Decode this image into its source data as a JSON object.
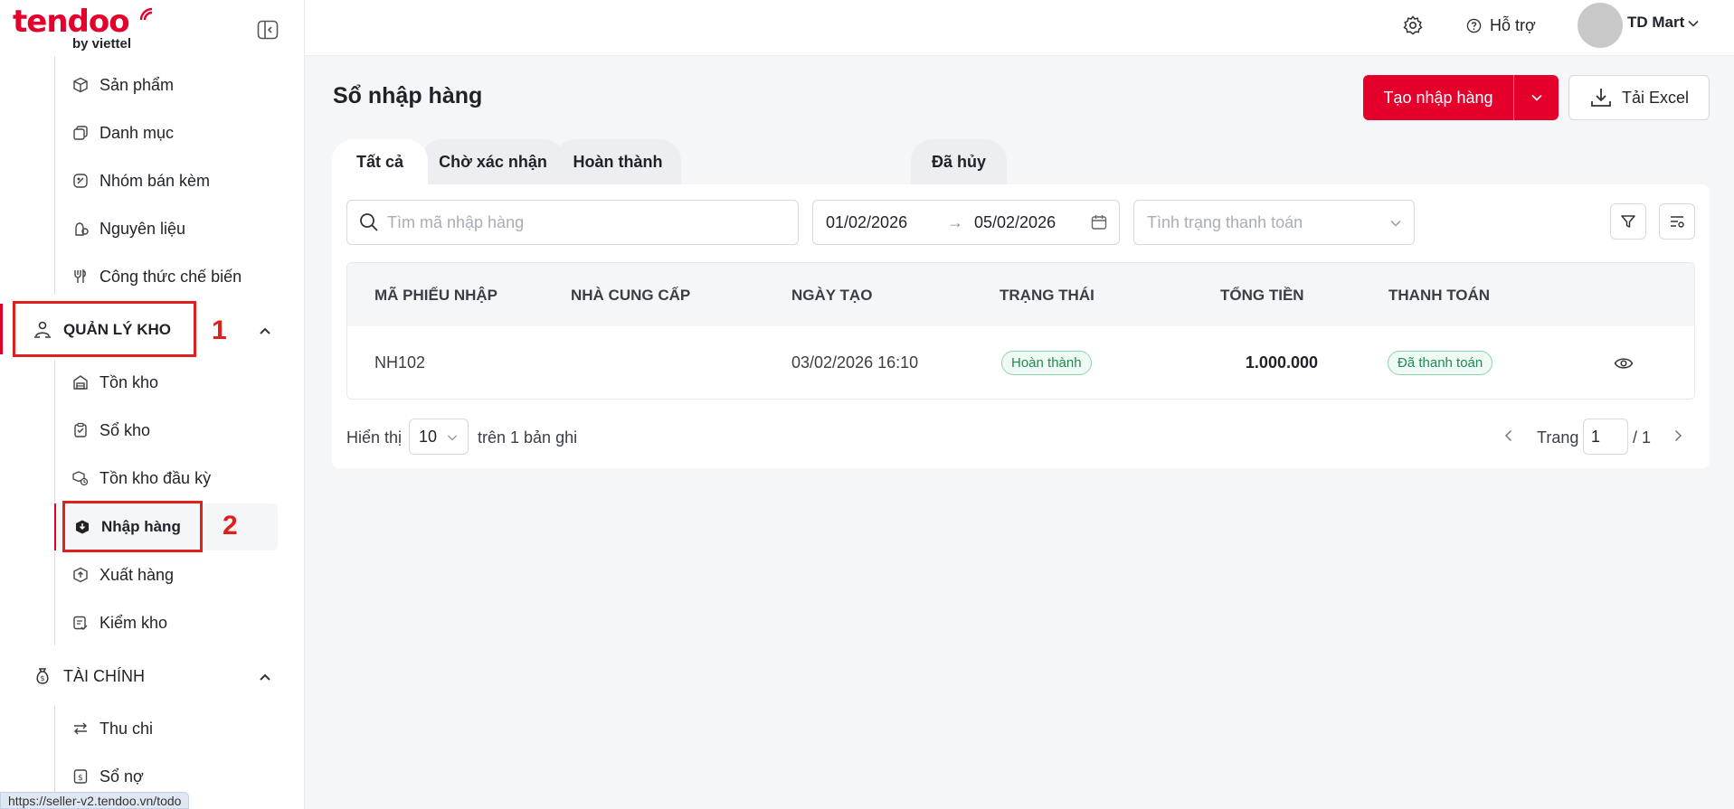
{
  "brand": {
    "logo_text": "tendoo",
    "logo_sub": "by viettel"
  },
  "sidebar": {
    "top_items": [
      {
        "label": "Sản phẩm",
        "icon": "cube-icon"
      },
      {
        "label": "Danh mục",
        "icon": "copy-icon"
      },
      {
        "label": "Nhóm bán kèm",
        "icon": "tag-icon"
      },
      {
        "label": "Nguyên liệu",
        "icon": "ingredient-icon"
      },
      {
        "label": "Công thức chế biến",
        "icon": "recipe-icon"
      }
    ],
    "section_inventory": {
      "label": "QUẢN LÝ KHO",
      "icon": "warehouse-user-icon"
    },
    "inventory_items": [
      {
        "label": "Tồn kho",
        "icon": "warehouse-icon"
      },
      {
        "label": "Sổ kho",
        "icon": "clipboard-icon"
      },
      {
        "label": "Tồn kho đầu kỳ",
        "icon": "boxes-icon"
      },
      {
        "label": "Nhập hàng",
        "icon": "box-in-icon"
      },
      {
        "label": "Xuất hàng",
        "icon": "box-out-icon"
      },
      {
        "label": "Kiểm kho",
        "icon": "checklist-icon"
      }
    ],
    "section_finance": {
      "label": "TÀI CHÍNH",
      "icon": "money-bag-icon"
    },
    "finance_items": [
      {
        "label": "Thu chi",
        "icon": "swap-icon"
      },
      {
        "label": "Sổ nợ",
        "icon": "debt-icon"
      }
    ]
  },
  "annotations": {
    "box1_number": "1",
    "box2_number": "2"
  },
  "status_url": "https://seller-v2.tendoo.vn/todo",
  "header": {
    "help_label": "Hỗ trợ",
    "user_name": "TD Mart"
  },
  "main": {
    "title": "Sổ nhập hàng",
    "create_button": "Tạo nhập hàng",
    "excel_button": "Tải Excel",
    "tabs": [
      "Tất cả",
      "Chờ xác nhận",
      "Hoàn thành",
      "Đã hủy"
    ],
    "search_placeholder": "Tìm mã nhập hàng",
    "date_from": "01/02/2026",
    "date_arrow": "→",
    "date_to": "05/02/2026",
    "payment_placeholder": "Tình trạng thanh toán",
    "table": {
      "columns": [
        "MÃ PHIẾU NHẬP",
        "NHÀ CUNG CẤP",
        "NGÀY TẠO",
        "TRẠNG THÁI",
        "TỔNG TIỀN",
        "THANH TOÁN"
      ],
      "rows": [
        {
          "code": "NH102",
          "supplier": "",
          "created": "03/02/2026 16:10",
          "status": "Hoàn thành",
          "total": "1.000.000",
          "payment": "Đã thanh toán"
        }
      ]
    },
    "footer": {
      "show_label": "Hiển thị",
      "page_size": "10",
      "total_label": "trên 1 bản ghi",
      "page_label": "Trang",
      "page_current": "1",
      "page_total": "/ 1"
    }
  },
  "colors": {
    "brand_red": "#e4002b",
    "annotation_red": "#e0201d",
    "success_green": "#1f8a52"
  }
}
